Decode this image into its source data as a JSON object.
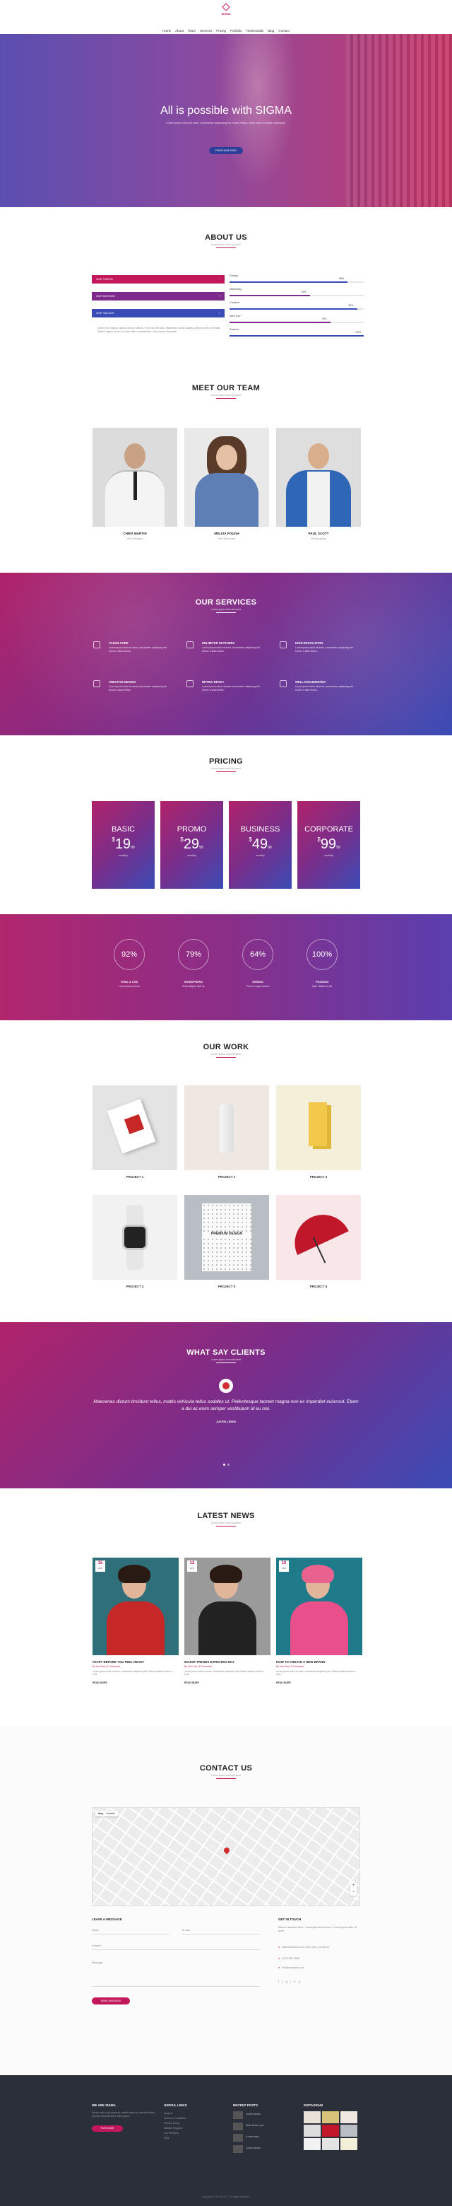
{
  "brand": {
    "name": "SIGMA",
    "tagline": "..."
  },
  "nav": [
    "Home",
    "About",
    "Team",
    "Services",
    "Pricing",
    "Portfolio",
    "Testimonials",
    "Blog",
    "Contact"
  ],
  "hero": {
    "title": "All is possible with SIGMA",
    "text": "Lorem ipsum dolor sit amet, consectetur adipiscing elit. Nulla efficitur, tortor vitae volutpat consequat.",
    "button": "PURCHASE NOW"
  },
  "about": {
    "title": "ABOUT US",
    "sub": "Lorem ipsum dolor sit amet",
    "tabs": [
      "OUR VISION",
      "OUR MISSION",
      "OUR VALUES"
    ],
    "text": "Donec nec magna, dapibus ipsum ultrices. Proin sed elit ante. Maecenas varius sagittis, pretium enim venenatis. Nullam sapien auctor, a luctus nibh condimentum. Nunc ipsum vulputate.",
    "skills": [
      {
        "name": "Design",
        "value": "88%",
        "pct": 0.88
      },
      {
        "name": "Marketing",
        "value": "60%",
        "pct": 0.6
      },
      {
        "name": "Creative",
        "value": "95%",
        "pct": 0.95
      },
      {
        "name": "Web Dev",
        "value": "75%",
        "pct": 0.75
      },
      {
        "name": "Passion",
        "value": "100%",
        "pct": 1.0
      }
    ]
  },
  "team": {
    "title": "MEET OUR TEAM",
    "sub": "Lorem ipsum dolor sit amet",
    "members": [
      {
        "name": "CHRIS MARTIN",
        "role": "Web Designer"
      },
      {
        "name": "MELISA POUGH",
        "role": "Web Developer"
      },
      {
        "name": "PAUL SCOTT",
        "role": "Photographer"
      }
    ]
  },
  "services": {
    "title": "OUR SERVICES",
    "sub": "Lorem ipsum dolor sit amet",
    "items": [
      {
        "t": "CLEAN CODE",
        "d": "Lorem ipsum dolor sit amet, consectetur adipiscing elit. Donec a diam lectus."
      },
      {
        "t": "UNLIMITED FEATURES",
        "d": "Lorem ipsum dolor sit amet, consectetur adipiscing elit. Donec a diam lectus."
      },
      {
        "t": "HIGH RESOLUTION",
        "d": "Lorem ipsum dolor sit amet, consectetur adipiscing elit. Donec a diam lectus."
      },
      {
        "t": "CREATIVE DESIGN",
        "d": "Lorem ipsum dolor sit amet, consectetur adipiscing elit. Donec a diam lectus."
      },
      {
        "t": "RETINA READY",
        "d": "Lorem ipsum dolor sit amet, consectetur adipiscing elit. Donec a diam lectus."
      },
      {
        "t": "WELL DOCUMENTED",
        "d": "Lorem ipsum dolor sit amet, consectetur adipiscing elit. Donec a diam lectus."
      }
    ]
  },
  "pricing": {
    "title": "PRICING",
    "sub": "Lorem ipsum dolor sit amet",
    "plans": [
      {
        "name": "BASIC",
        "price": "19",
        "cents": "99",
        "per": "monthly"
      },
      {
        "name": "PROMO",
        "price": "29",
        "cents": "99",
        "per": "monthly"
      },
      {
        "name": "BUSINESS",
        "price": "49",
        "cents": "99",
        "per": "monthly"
      },
      {
        "name": "CORPORATE",
        "price": "99",
        "cents": "99",
        "per": "monthly"
      }
    ]
  },
  "stats": [
    {
      "v": "92%",
      "l": "HTML & CSS",
      "d": "Lorem ipsum sit am"
    },
    {
      "v": "79%",
      "l": "WORDPRESS",
      "d": "Morbi aliquet nibh ac"
    },
    {
      "v": "64%",
      "l": "DESIGN",
      "d": "Proin in augue dictum"
    },
    {
      "v": "100%",
      "l": "PASSION",
      "d": "Nam efficitur a nisi"
    }
  ],
  "work": {
    "title": "OUR WORK",
    "sub": "Lorem ipsum dolor sit amet",
    "items": [
      "PROJECT 1",
      "PROJECT 2",
      "PROJECT 3",
      "PROJECT 4",
      "PROJECT 5",
      "PROJECT 6"
    ],
    "poster_text": "PREMIUM DESIGN"
  },
  "clients": {
    "title": "WHAT SAY CLIENTS",
    "sub": "Lorem ipsum dolor sit amet",
    "quote": "Maecenas dictum tincidunt tellus, mattis vehicula tellus sodales ut. Pellentesque laoreet magna non ex imperdiet euismod. Etiam a dui ac enim semper vestibulum id eu nisi.",
    "author": "JUSTIN LEWIS"
  },
  "news": {
    "title": "LATEST NEWS",
    "sub": "Lorem ipsum dolor sit amet",
    "posts": [
      {
        "day": "15",
        "mon": "APR",
        "t": "START BEFORE YOU FEEL READY",
        "m": "By John Doe  |  2 Comments",
        "d": "Lorem ipsum dolor sit amet, consectetur adipiscing elit. Nullam dapibus lectus a eros.",
        "r": "READ MORE"
      },
      {
        "day": "12",
        "mon": "APR",
        "t": "MAJOR TRENDS EXPECTED 2017",
        "m": "By John Doe  |  2 Comments",
        "d": "Lorem ipsum dolor sit amet, consectetur adipiscing elit. Nullam dapibus lectus a eros.",
        "r": "READ MORE"
      },
      {
        "day": "10",
        "mon": "APR",
        "t": "HOW TO CREATE A NEW BRAND",
        "m": "By John Doe  |  2 Comments",
        "d": "Lorem ipsum dolor sit amet, consectetur adipiscing elit. Nullam dapibus lectus a eros.",
        "r": "READ MORE"
      }
    ]
  },
  "contact": {
    "title": "CONTACT US",
    "sub": "Lorem ipsum dolor sit amet",
    "map_tabs": [
      "Map",
      "Satellite"
    ],
    "form_title": "LEAVE A MESSAGE",
    "name": "Name",
    "email": "E-mail",
    "subject": "Subject",
    "message": "Message",
    "send": "SEND MESSAGE",
    "touch_title": "GET IN TOUCH",
    "touch_text": "Etiam et tincidunt libero, consequat dictum lorem. Lorem ipsum dolor sit amet.",
    "address": "1856 Kibbleston Ave New York, CA 95124",
    "phone": "(123) 456-7890",
    "email_addr": "info@company.com"
  },
  "footer": {
    "c1t": "WE ARE SIGMA",
    "c1d": "Donec sem a dui placerat, mattis turpis ut, pharetra tellus. Aenean sit amet tortor vitae ipsum.",
    "c1b": "PURCHASE",
    "c2t": "USEFUL LINKS",
    "links": [
      "Support",
      "Terms & Conditions",
      "Privacy Policy",
      "Affiliate Program",
      "Our Partners",
      "FAQ"
    ],
    "c3t": "RECENT POSTS",
    "posts": [
      "Lorem Ipsum",
      "Start before you",
      "A new hope",
      "Lorem Ipsum"
    ],
    "c4t": "INSTAGRAM",
    "copy": "Copyright © SIGMA 2017. All rights reserved."
  },
  "colors": {
    "accent": "#c2185b",
    "indigo": "#3a4bb5",
    "dark": "#2b2f3a"
  }
}
